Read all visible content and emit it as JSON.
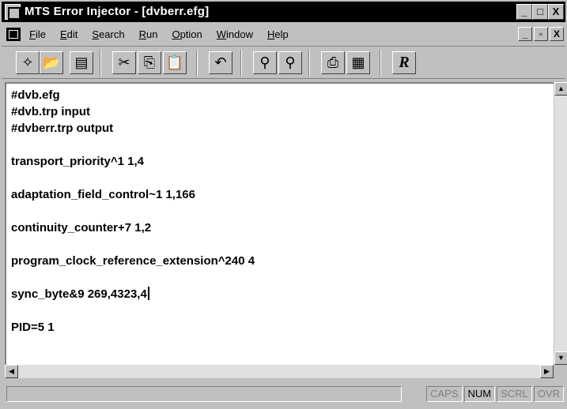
{
  "window": {
    "title": "MTS Error Injector - [dvberr.efg]",
    "controls": [
      "_",
      "□",
      "X"
    ]
  },
  "menubar": {
    "items": [
      {
        "label": "File",
        "u": "F",
        "rest": "ile"
      },
      {
        "label": "Edit",
        "u": "E",
        "rest": "dit"
      },
      {
        "label": "Search",
        "u": "S",
        "rest": "earch"
      },
      {
        "label": "Run",
        "u": "R",
        "rest": "un"
      },
      {
        "label": "Option",
        "u": "O",
        "rest": "ption"
      },
      {
        "label": "Window",
        "u": "W",
        "rest": "indow"
      },
      {
        "label": "Help",
        "u": "H",
        "rest": "elp"
      }
    ],
    "mdi_controls": [
      "_",
      "▫",
      "X"
    ]
  },
  "toolbar": {
    "buttons": [
      {
        "name": "new-icon",
        "glyph": "✧"
      },
      {
        "name": "open-icon",
        "glyph": "📂"
      },
      {
        "name": "save-icon",
        "glyph": "▤"
      },
      {
        "name": "cut-icon",
        "glyph": "✂"
      },
      {
        "name": "copy-icon",
        "glyph": "⎘"
      },
      {
        "name": "paste-icon",
        "glyph": "📋"
      },
      {
        "name": "undo-icon",
        "glyph": "↶"
      },
      {
        "name": "find-icon",
        "glyph": "⚲"
      },
      {
        "name": "replace-icon",
        "glyph": "⚲"
      },
      {
        "name": "print-icon",
        "glyph": "⎙"
      },
      {
        "name": "print-preview-icon",
        "glyph": "▦"
      },
      {
        "name": "run-icon",
        "glyph": "R"
      }
    ]
  },
  "editor": {
    "lines": [
      "#dvb.efg",
      "#dvb.trp input",
      "#dvberr.trp output",
      "",
      "transport_priority^1 1,4",
      "",
      "adaptation_field_control~1 1,166",
      "",
      "continuity_counter+7 1,2",
      "",
      "program_clock_reference_extension^240 4",
      "",
      "sync_byte&9 269,4323,4",
      "",
      "PID=5 1"
    ]
  },
  "statusbar": {
    "indicators": [
      {
        "label": "CAPS",
        "active": false
      },
      {
        "label": "NUM",
        "active": true
      },
      {
        "label": "SCRL",
        "active": false
      },
      {
        "label": "OVR",
        "active": false
      }
    ]
  }
}
